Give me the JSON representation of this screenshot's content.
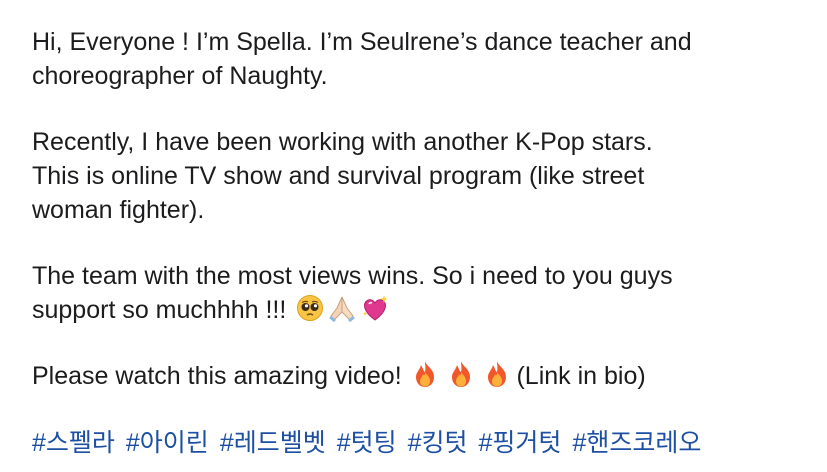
{
  "post": {
    "paragraph_1": "Hi, Everyone ! I’m Spella. I’m Seulrene’s dance teacher and\nchoreographer of Naughty.",
    "paragraph_2": "Recently, I have been working with another K-Pop stars.\nThis is online TV show and survival program (like street\nwoman fighter).",
    "paragraph_3": "The team with the most views wins. So i need to you guys\nsupport so muchhhh !!!",
    "paragraph_3_emojis": [
      "pleading-face",
      "folded-hands",
      "sparkling-heart"
    ],
    "paragraph_4_before": "Please watch this amazing video!",
    "paragraph_4_emojis": [
      "fire",
      "fire",
      "fire"
    ],
    "paragraph_4_after": "(Link in bio)",
    "hashtags": [
      "#스펠라",
      "#아이린",
      "#레드벨벳",
      "#텃팅",
      "#킹텃",
      "#핑거텃",
      "#핸즈코레오"
    ]
  },
  "colors": {
    "text": "#1c1c1e",
    "hashtag": "#1d4fa3",
    "background": "#ffffff"
  }
}
